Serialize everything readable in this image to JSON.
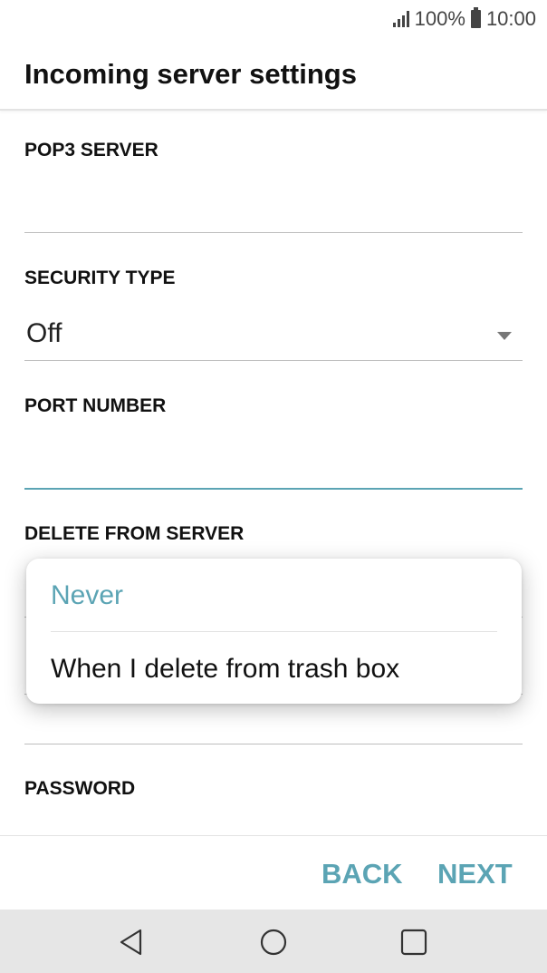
{
  "status_bar": {
    "battery": "100%",
    "time": "10:00",
    "signal_icon": "signal-bars-icon",
    "battery_icon": "battery-full-icon"
  },
  "app_bar": {
    "title": "Incoming server settings"
  },
  "form": {
    "pop3_server": {
      "label": "POP3 SERVER",
      "value": ""
    },
    "security_type": {
      "label": "SECURITY TYPE",
      "value": "Off"
    },
    "port_number": {
      "label": "PORT NUMBER",
      "value": ""
    },
    "delete_from_server": {
      "label": "DELETE FROM SERVER"
    },
    "password": {
      "label": "PASSWORD"
    }
  },
  "popup": {
    "options": [
      "Never",
      "When I delete from trash box"
    ],
    "selected_index": 0
  },
  "actions": {
    "back_label": "BACK",
    "next_label": "NEXT"
  },
  "colors": {
    "accent": "#5ba4b4",
    "text": "#111111",
    "divider": "#bdbdbd",
    "nav_bar": "#e6e6e6"
  }
}
